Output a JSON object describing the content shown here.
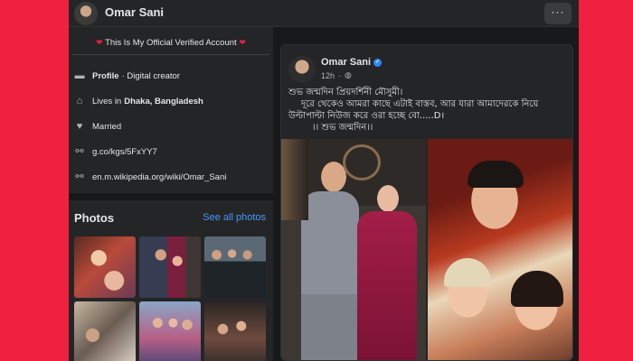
{
  "profile": {
    "name": "Omar Sani"
  },
  "topbar": {
    "more_label": "···"
  },
  "intro": {
    "bio": "This Is My Official Verified Account",
    "details": [
      {
        "icon": "briefcase-icon",
        "bold": "Profile",
        "text": " · Digital creator"
      },
      {
        "icon": "home-icon",
        "bold": "",
        "text": "Lives in ",
        "strong_suffix": "Dhaka, Bangladesh"
      },
      {
        "icon": "heart-icon",
        "bold": "",
        "text": "Married"
      },
      {
        "icon": "link-icon",
        "bold": "",
        "text": "g.co/kgs/5FxYY7"
      },
      {
        "icon": "link-icon",
        "bold": "",
        "text": "en.m.wikipedia.org/wiki/Omar_Sani"
      }
    ]
  },
  "photos": {
    "title": "Photos",
    "see_all": "See all photos"
  },
  "post": {
    "author": "Omar Sani",
    "time": "12h",
    "lines": [
      "শুভ জন্মদিন প্রিয়দর্শিনী মৌসুমী।",
      "দূরে থেকেও আমরা কাছে এটাই বাস্তব, আর যারা আমাদেরকে নিয়ে",
      "উল্টাপাল্টা নিউজ করে ওরা হচ্ছে বো.....D।",
      "।। শুভ জন্মদিন।।"
    ]
  },
  "colors": {
    "outer_background": "#f0213f",
    "page_background": "#18191a",
    "card_background": "#242526",
    "link_blue": "#4599ff",
    "verified_blue": "#2d88ff"
  }
}
